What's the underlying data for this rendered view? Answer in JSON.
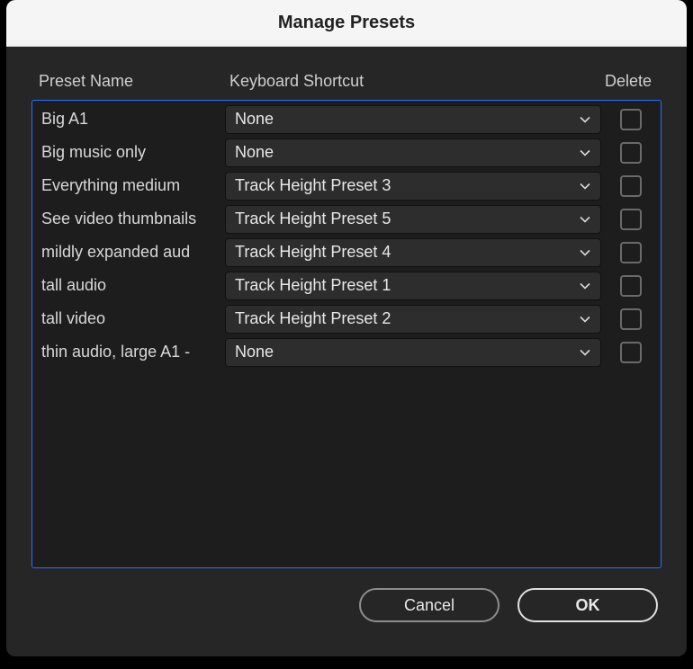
{
  "dialog": {
    "title": "Manage Presets"
  },
  "headers": {
    "name": "Preset Name",
    "shortcut": "Keyboard Shortcut",
    "delete": "Delete"
  },
  "presets": [
    {
      "name": "Big A1",
      "shortcut": "None"
    },
    {
      "name": "Big music only",
      "shortcut": "None"
    },
    {
      "name": "Everything medium",
      "shortcut": "Track Height Preset 3"
    },
    {
      "name": "See video thumbnails",
      "shortcut": "Track Height Preset 5"
    },
    {
      "name": "mildly expanded aud",
      "shortcut": "Track Height Preset 4"
    },
    {
      "name": "tall audio",
      "shortcut": "Track Height Preset 1"
    },
    {
      "name": "tall video",
      "shortcut": "Track Height Preset 2"
    },
    {
      "name": "thin audio, large A1 -",
      "shortcut": "None"
    }
  ],
  "buttons": {
    "cancel": "Cancel",
    "ok": "OK"
  }
}
